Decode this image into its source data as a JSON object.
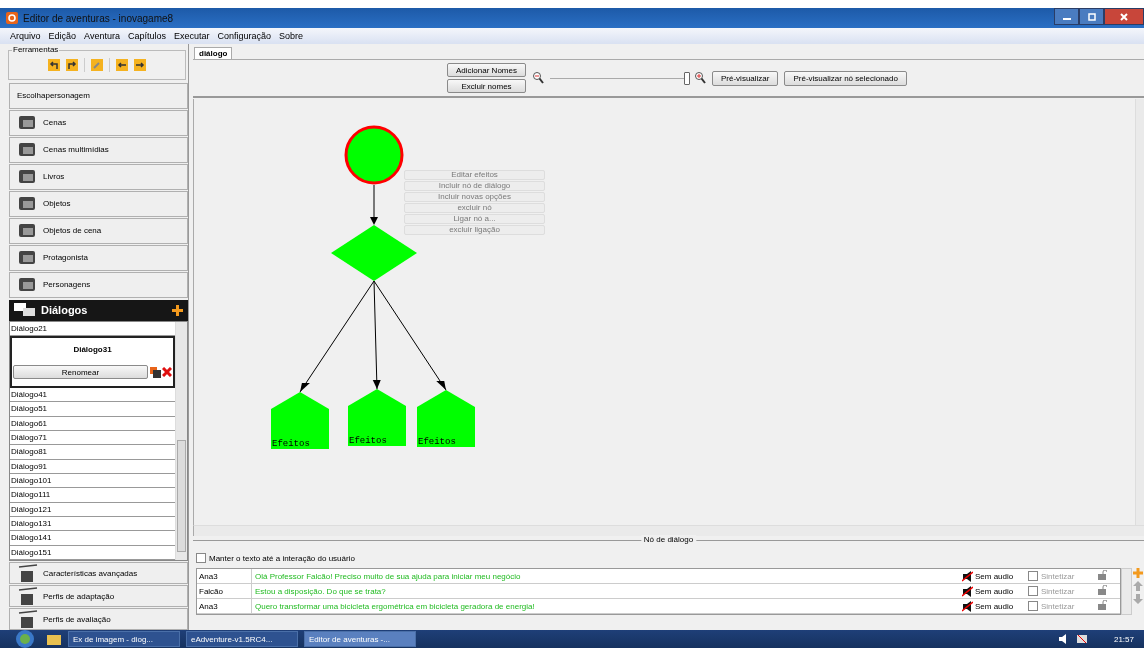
{
  "window": {
    "title": "Editor de aventuras - inovagame8"
  },
  "menu": [
    "Arquivo",
    "Edição",
    "Aventura",
    "Capítulos",
    "Executar",
    "Configuração",
    "Sobre"
  ],
  "toolbox": {
    "title": "Ferramentas"
  },
  "sidebar": {
    "items_top": [
      {
        "label": "Escolhapersonagem"
      },
      {
        "label": "Cenas"
      },
      {
        "label": "Cenas multimídias"
      },
      {
        "label": "Livros"
      },
      {
        "label": "Objetos"
      },
      {
        "label": "Objetos de cena"
      },
      {
        "label": "Protagonista"
      },
      {
        "label": "Personagens"
      }
    ],
    "dialogs": {
      "title": "Diálogos",
      "rename_button": "Renomear",
      "items": [
        {
          "label": "Diálogo21",
          "selected": false
        },
        {
          "label": "Diálogo31",
          "selected": true
        },
        {
          "label": "Diálogo41",
          "selected": false
        },
        {
          "label": "Diálogo51",
          "selected": false
        },
        {
          "label": "Diálogo61",
          "selected": false
        },
        {
          "label": "Diálogo71",
          "selected": false
        },
        {
          "label": "Diálogo81",
          "selected": false
        },
        {
          "label": "Diálogo91",
          "selected": false
        },
        {
          "label": "Diálogo101",
          "selected": false
        },
        {
          "label": "Diálogo111",
          "selected": false
        },
        {
          "label": "Diálogo121",
          "selected": false
        },
        {
          "label": "Diálogo131",
          "selected": false
        },
        {
          "label": "Diálogo141",
          "selected": false
        },
        {
          "label": "Diálogo151",
          "selected": false
        }
      ]
    },
    "items_bottom": [
      {
        "label": "Características avançadas"
      },
      {
        "label": "Perfis de adaptação"
      },
      {
        "label": "Perfis de avaliação"
      }
    ]
  },
  "tabs": [
    {
      "label": "diálogo",
      "selected": true
    }
  ],
  "toolbar": {
    "names_buttons": [
      "Adicionar Nomes",
      "Excluir nomes"
    ],
    "zoom": {
      "level": 1
    },
    "preview_buttons": [
      "Pré-visualizar",
      "Pré-visualizar nó selecionado"
    ]
  },
  "diagram": {
    "leaf_labels": [
      "Efeitos",
      "Efeitos",
      "Efeitos"
    ],
    "context_menu": [
      {
        "label": "Editar efeitos",
        "disabled": true
      },
      {
        "label": "Incluir nó de diálogo",
        "disabled": true
      },
      {
        "label": "Incluir novas opções",
        "disabled": true
      },
      {
        "label": "excluir nó",
        "disabled": true
      },
      {
        "label": "Ligar nó a...",
        "disabled": true
      },
      {
        "label": "excluir ligação",
        "disabled": true
      }
    ]
  },
  "node_panel": {
    "title": "Nó de diálogo",
    "keep_text": {
      "label": "Manter o texto até a interação do usuário",
      "checked": false
    },
    "lines": [
      {
        "speaker": "Ana3",
        "text": "Olá Professor Falcão! Preciso muito de sua ajuda para iniciar meu negócio",
        "audio": "Sem audio",
        "synth": "Sintetizar",
        "synth_checked": false
      },
      {
        "speaker": "Falcão",
        "text": "Estou a disposição. Do que se trata?",
        "audio": "Sem audio",
        "synth": "Sintetizar",
        "synth_checked": false
      },
      {
        "speaker": "Ana3",
        "text": "Quero transformar uma bicicleta ergométrica em bicicleta geradora de energia!",
        "audio": "Sem audio",
        "synth": "Sintetizar",
        "synth_checked": false
      }
    ]
  },
  "taskbar": {
    "items": [
      {
        "label": "Ex de imagem - diog...",
        "selected": false
      },
      {
        "label": "eAdventure-v1.5RC4...",
        "selected": false
      },
      {
        "label": "Editor de aventuras -...",
        "selected": true
      }
    ],
    "clock": "21:57"
  }
}
